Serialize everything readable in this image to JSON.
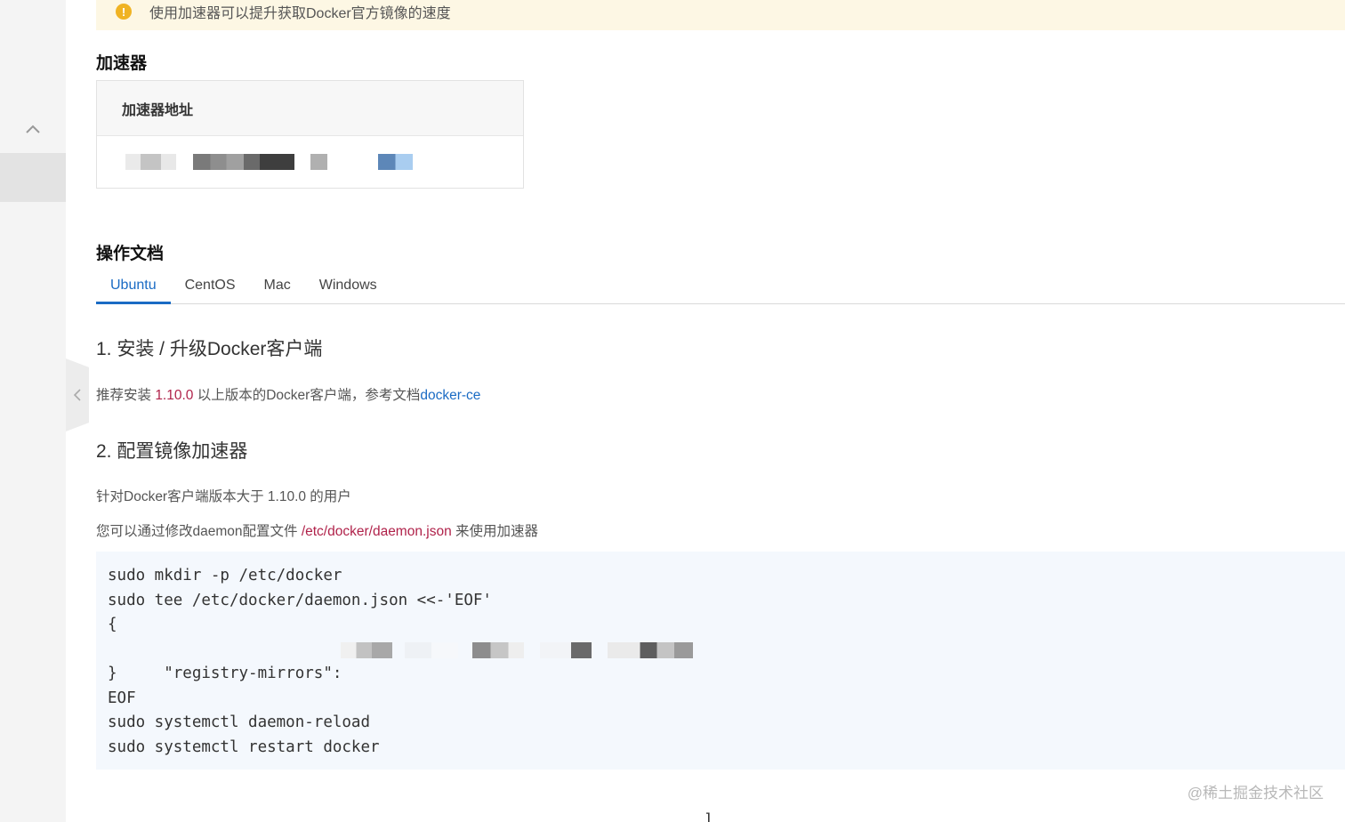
{
  "notice": {
    "text": "使用加速器可以提升获取Docker官方镜像的速度",
    "icon": "warning-icon"
  },
  "accelerator": {
    "title": "加速器",
    "card_header": "加速器地址"
  },
  "docs": {
    "title": "操作文档",
    "tabs": [
      {
        "label": "Ubuntu",
        "active": true
      },
      {
        "label": "CentOS",
        "active": false
      },
      {
        "label": "Mac",
        "active": false
      },
      {
        "label": "Windows",
        "active": false
      }
    ],
    "step1": {
      "heading": "1. 安装 / 升级Docker客户端",
      "text_before": "推荐安装 ",
      "version": "1.10.0",
      "text_mid": " 以上版本的Docker客户端，参考文档",
      "link": "docker-ce"
    },
    "step2": {
      "heading": "2. 配置镜像加速器",
      "line1": "针对Docker客户端版本大于 1.10.0 的用户",
      "line2_before": "您可以通过修改daemon配置文件 ",
      "line2_path": "/etc/docker/daemon.json",
      "line2_after": " 来使用加速器"
    },
    "code": {
      "l1": "sudo mkdir -p /etc/docker",
      "l2": "sudo tee /etc/docker/daemon.json <<-'EOF'",
      "l3": "{",
      "l4": "  \"registry-mirrors\":",
      "l4_end": "]",
      "l5": "}",
      "l6": "EOF",
      "l7": "sudo systemctl daemon-reload",
      "l8": "sudo systemctl restart docker"
    }
  },
  "watermark": "@稀土掘金技术社区",
  "colors": {
    "accent": "#1a6bc4",
    "highlight": "#b0224a",
    "notice_bg": "#fdf7e4",
    "code_bg": "#f4f8fd"
  }
}
